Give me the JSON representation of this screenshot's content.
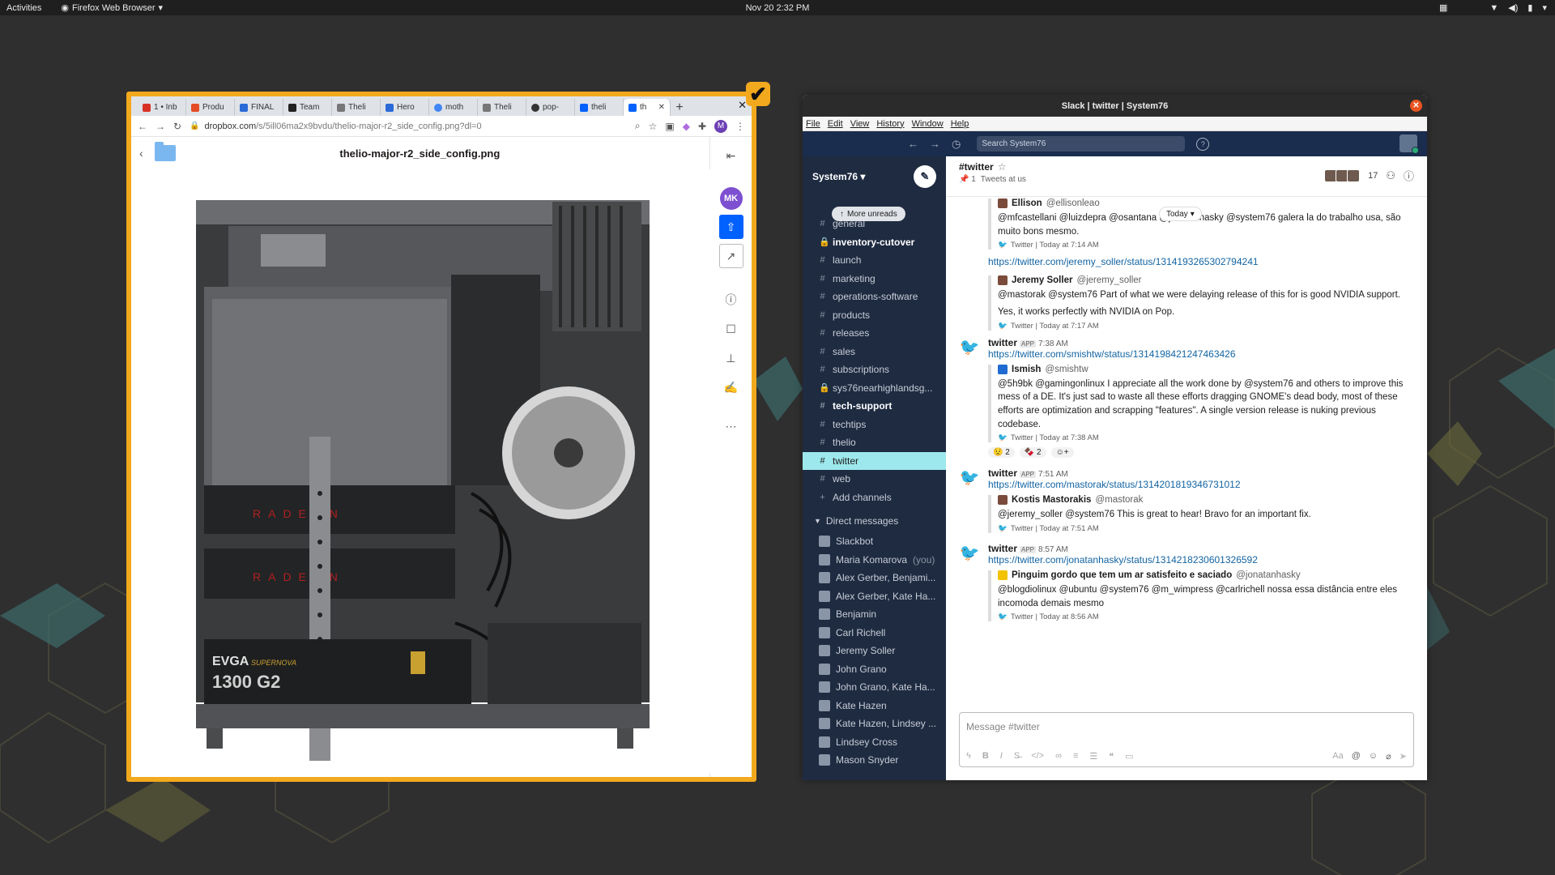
{
  "topbar": {
    "activities": "Activities",
    "app_name": "Firefox Web Browser",
    "clock": "Nov 20  2:32 PM"
  },
  "browser": {
    "tabs": [
      {
        "label": "1 • Inb",
        "color": "#d93025"
      },
      {
        "label": "Produ",
        "color": "#e44d26"
      },
      {
        "label": "FINAL",
        "color": "#2a6ad8"
      },
      {
        "label": "Team",
        "color": "#222222"
      },
      {
        "label": "Theli",
        "color": "#555555"
      },
      {
        "label": "Hero",
        "color": "#2a6ad8"
      },
      {
        "label": "moth",
        "color": "#4285f4"
      },
      {
        "label": "Theli",
        "color": "#555555"
      },
      {
        "label": "pop-",
        "color": "#333333"
      },
      {
        "label": "theli",
        "color": "#0061fe"
      },
      {
        "label": "th",
        "color": "#0061fe"
      }
    ],
    "url_domain": "dropbox.com",
    "url_path": "/s/5ill06ma2x9bvdu/thelio-major-r2_side_config.png?dl=0",
    "profile_initial": "M",
    "file_title": "thelio-major-r2_side_config.png",
    "avatar_initials": "MK",
    "photo_text": {
      "gpu_brand": "RADEON",
      "psu_brand": "EVGA",
      "psu_line": "SUPERNOVA",
      "psu_model": "1300 G2"
    }
  },
  "slack": {
    "window_title": "Slack | twitter | System76",
    "menus": [
      "File",
      "Edit",
      "View",
      "History",
      "Window",
      "Help"
    ],
    "search_placeholder": "Search System76",
    "workspace": "System76",
    "more_unreads": "More unreads",
    "channels": [
      {
        "name": "general",
        "bold": false,
        "lock": false
      },
      {
        "name": "inventory-cutover",
        "bold": true,
        "lock": true
      },
      {
        "name": "launch",
        "bold": false,
        "lock": false
      },
      {
        "name": "marketing",
        "bold": false,
        "lock": false
      },
      {
        "name": "operations-software",
        "bold": false,
        "lock": false
      },
      {
        "name": "products",
        "bold": false,
        "lock": false
      },
      {
        "name": "releases",
        "bold": false,
        "lock": false
      },
      {
        "name": "sales",
        "bold": false,
        "lock": false
      },
      {
        "name": "subscriptions",
        "bold": false,
        "lock": false
      },
      {
        "name": "sys76nearhighlandsg...",
        "bold": false,
        "lock": true
      },
      {
        "name": "tech-support",
        "bold": true,
        "lock": false
      },
      {
        "name": "techtips",
        "bold": false,
        "lock": false
      },
      {
        "name": "thelio",
        "bold": false,
        "lock": false
      },
      {
        "name": "twitter",
        "bold": false,
        "lock": false,
        "active": true
      },
      {
        "name": "web",
        "bold": false,
        "lock": false
      }
    ],
    "add_channels": "Add channels",
    "direct_messages_label": "Direct messages",
    "dms": [
      {
        "name": "Slackbot",
        "suffix": ""
      },
      {
        "name": "Maria Komarova",
        "suffix": "(you)"
      },
      {
        "name": "Alex Gerber, Benjami...",
        "suffix": ""
      },
      {
        "name": "Alex Gerber, Kate Ha...",
        "suffix": ""
      },
      {
        "name": "Benjamin",
        "suffix": ""
      },
      {
        "name": "Carl Richell",
        "suffix": ""
      },
      {
        "name": "Jeremy Soller",
        "suffix": ""
      },
      {
        "name": "John Grano",
        "suffix": ""
      },
      {
        "name": "John Grano, Kate Ha...",
        "suffix": ""
      },
      {
        "name": "Kate Hazen",
        "suffix": ""
      },
      {
        "name": "Kate Hazen, Lindsey ...",
        "suffix": ""
      },
      {
        "name": "Lindsey Cross",
        "suffix": ""
      },
      {
        "name": "Mason Snyder",
        "suffix": ""
      }
    ],
    "channel_header": {
      "name": "#twitter",
      "pins": "1",
      "topic": "Tweets at us",
      "member_count": "17"
    },
    "today_label": "Today",
    "messages": [
      {
        "type": "quote",
        "author": "Ellison",
        "handle": "@ellisonleao",
        "text": "@mfcastellani @luizdepra @osantana @jonatanhasky @system76 galera la do trabalho usa, são muito bons mesmo.",
        "footer": "Twitter | Today at 7:14 AM"
      },
      {
        "type": "link",
        "url": "https://twitter.com/jeremy_soller/status/1314193265302794241"
      },
      {
        "type": "quote",
        "author": "Jeremy Soller",
        "handle": "@jeremy_soller",
        "text": "@mastorak @system76 Part of what we were delaying release of this for is good NVIDIA support.",
        "text2": "Yes, it works perfectly with NVIDIA on Pop.",
        "footer": "Twitter | Today at 7:17 AM"
      },
      {
        "type": "post",
        "sender": "twitter",
        "badge": "APP",
        "time": "7:38 AM",
        "url": "https://twitter.com/smishtw/status/1314198421247463426",
        "quote_author": "Ismish",
        "quote_handle": "@smishtw",
        "quote_text": "@5h9bk @gamingonlinux I appreciate all the work done by @system76 and others to improve this mess of a DE. It's just sad to waste all these efforts dragging GNOME's dead body, most of these efforts are optimization and scrapping \"features\". A single version release is nuking previous codebase.",
        "footer": "Twitter | Today at 7:38 AM",
        "reactions": [
          "😟 2",
          "🍫 2",
          "☺+"
        ]
      },
      {
        "type": "post",
        "sender": "twitter",
        "badge": "APP",
        "time": "7:51 AM",
        "url": "https://twitter.com/mastorak/status/1314201819346731012",
        "quote_author": "Kostis Mastorakis",
        "quote_handle": "@mastorak",
        "quote_text": "@jeremy_soller @system76 This is great to hear! Bravo for an important fix.",
        "footer": "Twitter | Today at 7:51 AM"
      },
      {
        "type": "post",
        "sender": "twitter",
        "badge": "APP",
        "time": "8:57 AM",
        "url": "https://twitter.com/jonatanhasky/status/1314218230601326592",
        "quote_author": "Pinguim gordo que tem um ar satisfeito e saciado",
        "quote_handle": "@jonatanhasky",
        "quote_text": "@blogdiolinux @ubuntu @system76 @m_wimpress @carlrichell nossa essa distância entre eles incomoda demais mesmo",
        "footer": "Twitter | Today at 8:56 AM"
      }
    ],
    "composer_placeholder": "Message #twitter"
  }
}
